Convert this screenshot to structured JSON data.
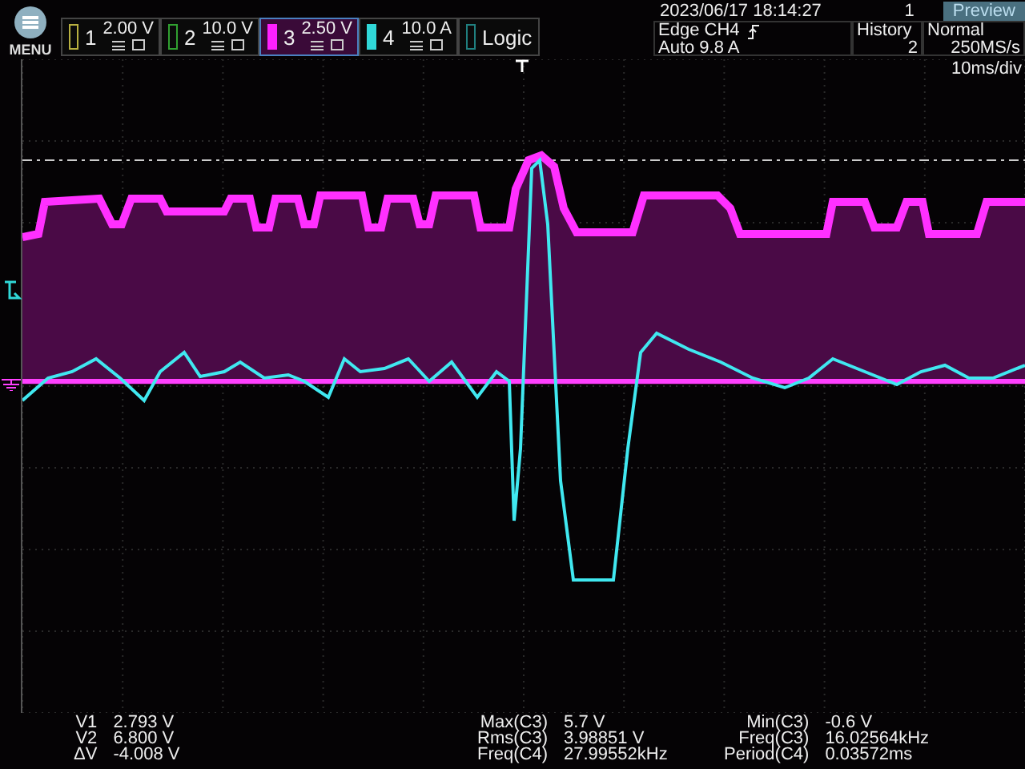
{
  "menu": {
    "label": "MENU"
  },
  "channels": [
    {
      "number": "1",
      "scale": "2.00 V",
      "color": "#b8b040",
      "selected": false
    },
    {
      "number": "2",
      "scale": "10.0 V",
      "color": "#30a030",
      "selected": false
    },
    {
      "number": "3",
      "scale": "2.50 V",
      "color": "#ff20ff",
      "selected": true
    },
    {
      "number": "4",
      "scale": "10.0 A",
      "color": "#30d8d8",
      "selected": false
    }
  ],
  "logic": {
    "label": "Logic"
  },
  "datetime": "2023/06/17 18:14:27",
  "acquisition_count": "1",
  "preview": "Preview",
  "trigger": {
    "source": "Edge CH4",
    "mode_level": "Auto 9.8 A"
  },
  "history": {
    "label": "History",
    "value": "2"
  },
  "acquisition": {
    "mode": "Normal",
    "sample_rate": "250MS/s"
  },
  "timebase": "10ms/div",
  "cursors": [
    {
      "label": "V1",
      "value": "2.793 V"
    },
    {
      "label": "V2",
      "value": "6.800 V"
    },
    {
      "label": "ΔV",
      "value": "-4.008 V"
    }
  ],
  "measurements": [
    {
      "label": "Max(C3)",
      "value": "5.7 V"
    },
    {
      "label": "Rms(C3)",
      "value": "3.98851 V"
    },
    {
      "label": "Freq(C4)",
      "value": "27.99552kHz"
    },
    {
      "label": "Min(C3)",
      "value": "-0.6 V"
    },
    {
      "label": "Freq(C3)",
      "value": "16.02564kHz"
    },
    {
      "label": "Period(C4)",
      "value": "0.03572ms"
    }
  ]
}
